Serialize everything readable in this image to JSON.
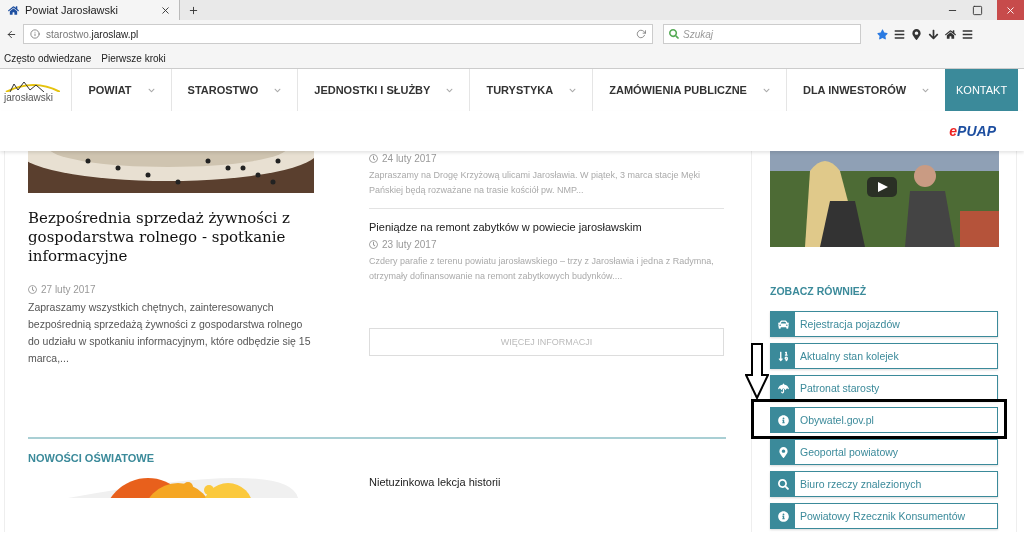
{
  "browser": {
    "tab_title": "Powiat Jarosławski",
    "url_host": "starostwo.",
    "url_domain": "jaroslaw.pl",
    "search_placeholder": "Szukaj",
    "bookmarks": [
      "Często odwiedzane",
      "Pierwsze kroki"
    ]
  },
  "site": {
    "logo_text": "jarosławski",
    "nav": [
      {
        "label": "POWIAT"
      },
      {
        "label": "STAROSTWO"
      },
      {
        "label": "JEDNOSTKI I SŁUŻBY"
      },
      {
        "label": "TURYSTYKA"
      },
      {
        "label": "ZAMÓWIENIA PUBLICZNE"
      },
      {
        "label": "DLA INWESTORÓW"
      }
    ],
    "contact_button": "KONTAKT",
    "epuap": {
      "lead": "e",
      "rest": "PUAP"
    }
  },
  "featured": {
    "kind": "picture",
    "title": "Bezpośrednia sprzedaż żywności z gospodarstwa rolnego - spotkanie informacyjne",
    "date": "27 luty 2017",
    "excerpt": "Zapraszamy wszystkich chętnych, zainteresowanych bezpośrednią sprzedażą żywności z gospodarstwa rolnego do udziału w spotkaniu informacyjnym, które odbędzie się 15 marca,..."
  },
  "news": [
    {
      "date": "24 luty 2017",
      "excerpt": "Zapraszamy na Drogę Krzyżową ulicami Jarosławia. W piątek, 3 marca stacje Męki Pańskiej będą rozważane na trasie kościół pw. NMP..."
    },
    {
      "title": "Pieniądze na remont zabytków w powiecie jarosławskim",
      "date": "23 luty 2017",
      "excerpt": "Czdery parafie z terenu powiatu jarosławskiego – trzy z Jarosławia i jedna z Radymna, otrzymały dofinansowanie na remont zabytkowych budynków...."
    }
  ],
  "more_button": "WIĘCEJ INFORMACJI",
  "education": {
    "heading": "NOWOŚCI OŚWIATOWE",
    "kind": "picture",
    "item_title": "Nietuzinkowa lekcja historii"
  },
  "sidebar": {
    "heading": "ZOBACZ RÓWNIEŻ",
    "links": [
      {
        "label": "Rejestracja pojazdów",
        "highlighted": false
      },
      {
        "label": "Aktualny stan kolejek",
        "highlighted": false
      },
      {
        "label": "Patronat starosty",
        "highlighted": false
      },
      {
        "label": "Obywatel.gov.pl",
        "highlighted": true
      },
      {
        "label": "Geoportal powiatowy",
        "highlighted": false
      },
      {
        "label": "Biuro rzeczy znalezionych",
        "highlighted": false
      },
      {
        "label": "Powiatowy Rzecznik Konsumentów",
        "highlighted": false
      }
    ]
  }
}
